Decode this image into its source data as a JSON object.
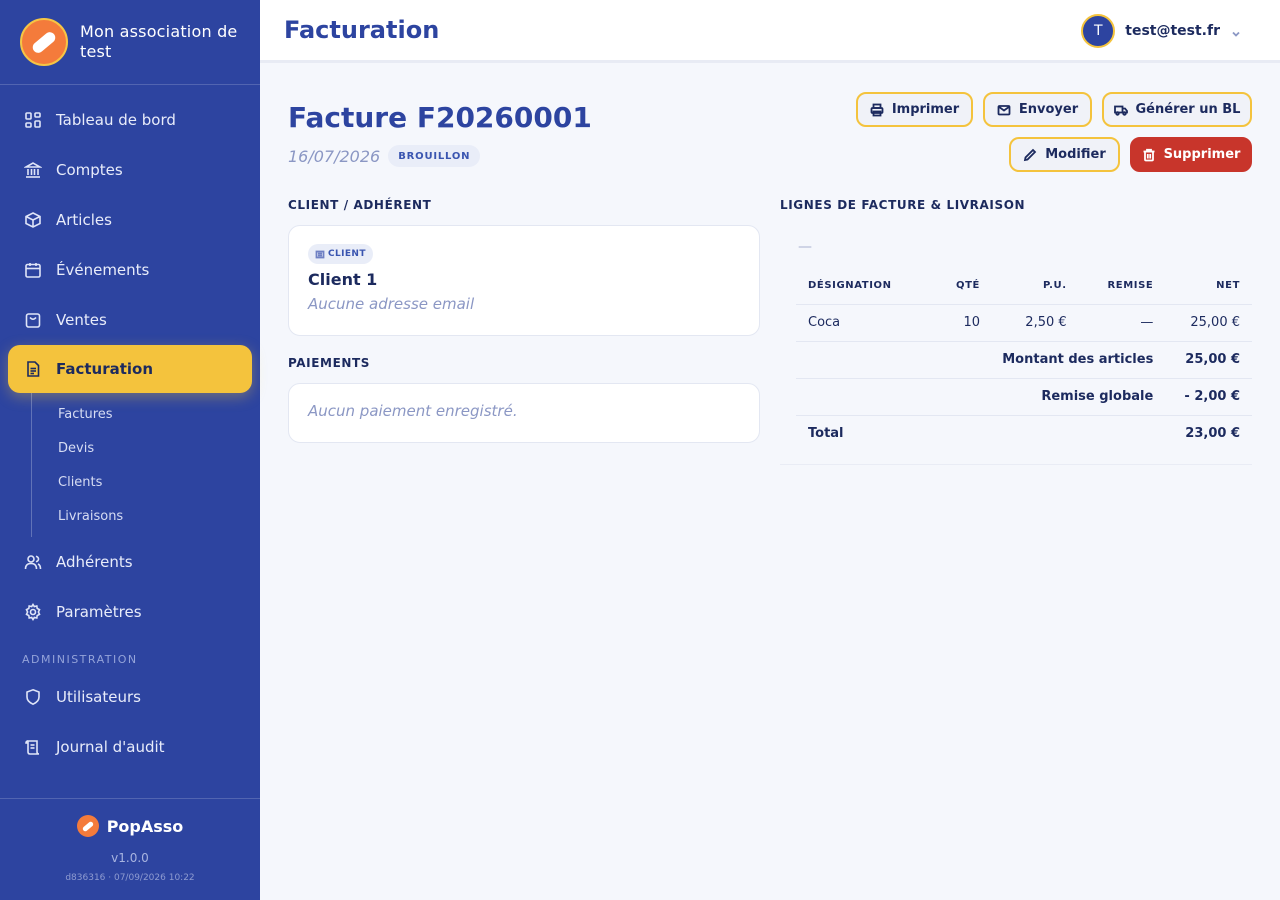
{
  "org": {
    "name": "Mon association de test"
  },
  "nav": {
    "items": [
      {
        "label": "Tableau de bord",
        "icon": "dashboard-icon"
      },
      {
        "label": "Comptes",
        "icon": "bank-icon"
      },
      {
        "label": "Articles",
        "icon": "box-icon"
      },
      {
        "label": "Événements",
        "icon": "calendar-icon"
      },
      {
        "label": "Ventes",
        "icon": "bag-icon"
      },
      {
        "label": "Facturation",
        "icon": "document-icon",
        "active": true
      }
    ],
    "sub_items": [
      "Factures",
      "Devis",
      "Clients",
      "Livraisons"
    ],
    "items_after": [
      {
        "label": "Adhérents",
        "icon": "users-icon"
      },
      {
        "label": "Paramètres",
        "icon": "gear-icon"
      }
    ],
    "admin_label": "ADMINISTRATION",
    "admin_items": [
      {
        "label": "Utilisateurs",
        "icon": "shield-icon"
      },
      {
        "label": "Journal d'audit",
        "icon": "scroll-icon"
      }
    ]
  },
  "footer": {
    "brand": "PopAsso",
    "version": "v1.0.0",
    "build": "d836316 · 07/09/2026 10:22"
  },
  "header": {
    "title": "Facturation",
    "user_initial": "T",
    "user_email": "test@test.fr"
  },
  "invoice": {
    "title": "Facture F20260001",
    "date": "16/07/2026",
    "status": "BROUILLON",
    "actions": {
      "print": "Imprimer",
      "send": "Envoyer",
      "delivery": "Générer un BL",
      "edit": "Modifier",
      "delete": "Supprimer"
    }
  },
  "client_section": {
    "label": "CLIENT / ADHÉRENT",
    "chip": "CLIENT",
    "name": "Client 1",
    "email": "Aucune adresse email"
  },
  "payments_section": {
    "label": "PAIEMENTS",
    "empty": "Aucun paiement enregistré."
  },
  "lines_section": {
    "label": "LIGNES DE FACTURE & LIVRAISON",
    "placeholder": "—",
    "columns": [
      "DÉSIGNATION",
      "QTÉ",
      "P.U.",
      "REMISE",
      "NET"
    ],
    "rows": [
      {
        "designation": "Coca",
        "qty": "10",
        "unit_price": "2,50 €",
        "discount": "—",
        "net": "25,00 €"
      }
    ],
    "subtotal_label": "Montant des articles",
    "subtotal": "25,00 €",
    "global_discount_label": "Remise globale",
    "global_discount": "- 2,00 €",
    "total_label": "Total",
    "total": "23,00 €"
  },
  "colors": {
    "sidebar": "#2d44a0",
    "accent": "#f4c33d",
    "danger": "#c8352b",
    "logo": "#f47b3b"
  }
}
